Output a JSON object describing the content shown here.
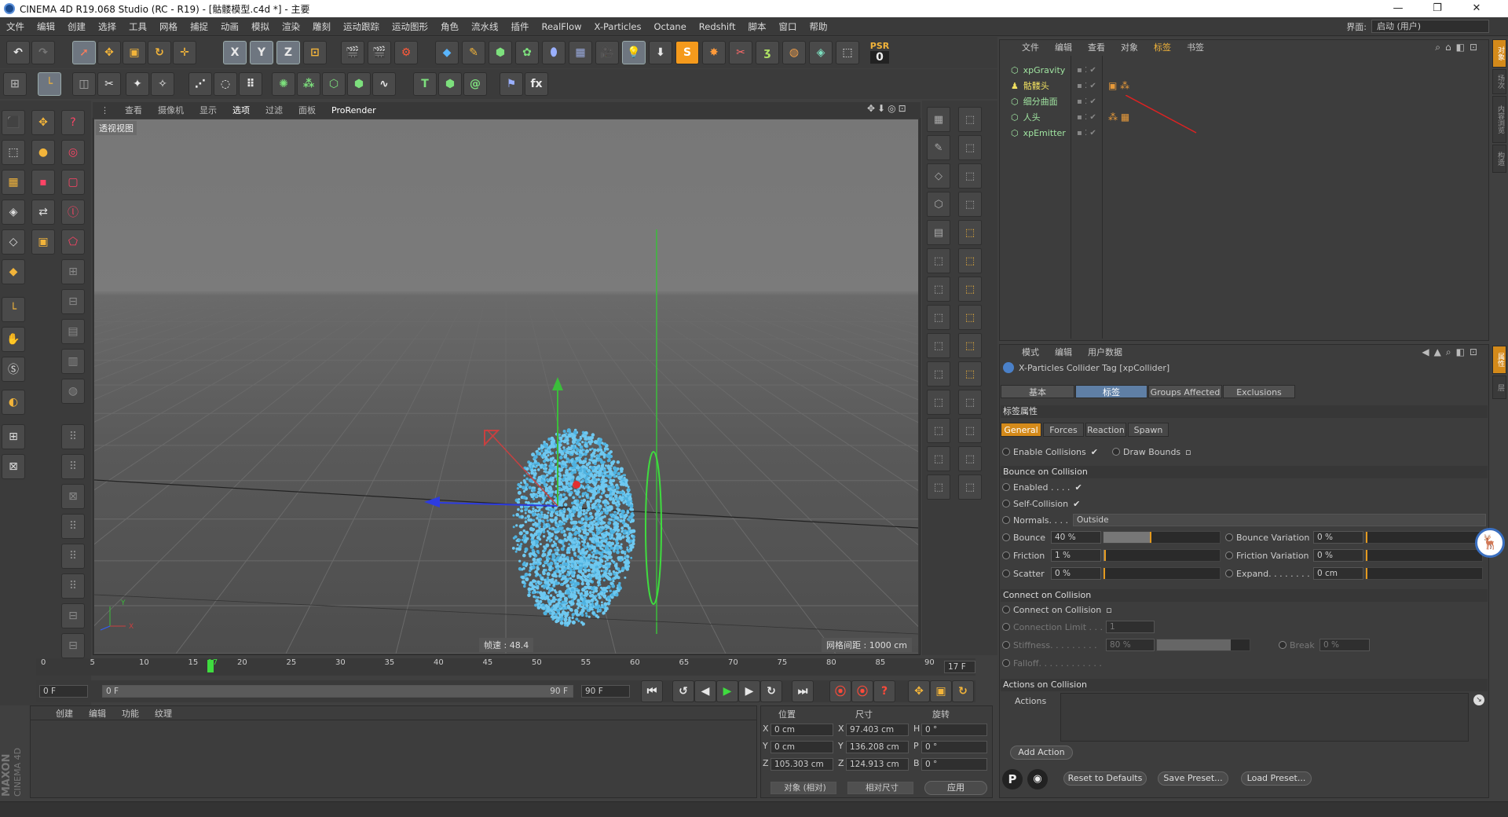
{
  "window": {
    "title": "CINEMA 4D R19.068 Studio (RC - R19) - [骷髅模型.c4d *] - 主要",
    "min": "—",
    "max": "❐",
    "close": "✕"
  },
  "menu": [
    "文件",
    "编辑",
    "创建",
    "选择",
    "工具",
    "网格",
    "捕捉",
    "动画",
    "模拟",
    "渲染",
    "雕刻",
    "运动跟踪",
    "运动图形",
    "角色",
    "流水线",
    "插件",
    "RealFlow",
    "X-Particles",
    "Octane",
    "Redshift",
    "脚本",
    "窗口",
    "帮助"
  ],
  "interface": {
    "label": "界面:",
    "value": "启动 (用户)"
  },
  "toolbar": {
    "x": "X",
    "y": "Y",
    "z": "Z",
    "psr_label": "PSR",
    "psr_value": "0"
  },
  "viewport": {
    "menu": [
      "查看",
      "摄像机",
      "显示",
      "选项",
      "过滤",
      "面板",
      "ProRender"
    ],
    "label": "透视视图",
    "fps": "帧速 : 48.4",
    "grid": "网格间距 : 1000 cm"
  },
  "timeline": {
    "ticks": [
      "0",
      "5",
      "10",
      "15",
      "17",
      "20",
      "25",
      "30",
      "35",
      "40",
      "45",
      "50",
      "55",
      "60",
      "65",
      "70",
      "75",
      "80",
      "85",
      "90"
    ],
    "current_frame": "17 F",
    "start": "0 F",
    "range_start": "0 F",
    "range_end": "90 F",
    "end": "90 F"
  },
  "materials": {
    "menu": [
      "创建",
      "编辑",
      "功能",
      "纹理"
    ],
    "brand1": "MAXON",
    "brand2": "CINEMA 4D"
  },
  "coords": {
    "headers": [
      "位置",
      "尺寸",
      "旋转"
    ],
    "rows": [
      {
        "a": "X",
        "pos": "0 cm",
        "b": "X",
        "size": "97.403 cm",
        "c": "H",
        "rot": "0 °"
      },
      {
        "a": "Y",
        "pos": "0 cm",
        "b": "Y",
        "size": "136.208 cm",
        "c": "P",
        "rot": "0 °"
      },
      {
        "a": "Z",
        "pos": "105.303 cm",
        "b": "Z",
        "size": "124.913 cm",
        "c": "B",
        "rot": "0 °"
      }
    ],
    "mode1": "对象 (相对)",
    "mode2": "相对尺寸",
    "apply": "应用"
  },
  "objects": {
    "menu": [
      "文件",
      "编辑",
      "查看",
      "对象",
      "标签",
      "书签"
    ],
    "items": [
      {
        "name": "xpGravity",
        "color": "#9fe3a0"
      },
      {
        "name": "骷髅头",
        "color": "#f0e060"
      },
      {
        "name": "细分曲面",
        "color": "#9fe3a0"
      },
      {
        "name": "人头",
        "color": "#9fe3a0"
      },
      {
        "name": "xpEmitter",
        "color": "#9fe3a0"
      }
    ]
  },
  "attributes": {
    "menu": [
      "模式",
      "编辑",
      "用户数据"
    ],
    "title": "X-Particles Collider Tag [xpCollider]",
    "tabs": [
      "基本",
      "标签",
      "Groups Affected",
      "Exclusions"
    ],
    "section": "标签属性",
    "subtabs": [
      "General",
      "Forces",
      "Reaction",
      "Spawn"
    ],
    "enable_collisions": "Enable Collisions",
    "draw_bounds": "Draw Bounds",
    "bounce_head": "Bounce on Collision",
    "enabled": "Enabled . . . .",
    "self_collision": "Self-Collision",
    "normals": "Normals. . . .",
    "normals_value": "Outside",
    "bounce": {
      "label": "Bounce",
      "value": "40 %",
      "level": 0.4
    },
    "bounce_var": {
      "label": "Bounce Variation",
      "value": "0 %"
    },
    "friction": {
      "label": "Friction",
      "value": "1 %",
      "level": 0.01
    },
    "friction_var": {
      "label": "Friction Variation",
      "value": "0 %"
    },
    "scatter": {
      "label": "Scatter",
      "value": "0 %"
    },
    "expand": {
      "label": "Expand. . . . . . . . .",
      "value": "0 cm"
    },
    "connect_head": "Connect on Collision",
    "connect": "Connect on Collision",
    "conn_limit": {
      "label": "Connection Limit . . .",
      "value": "1"
    },
    "stiffness": {
      "label": "Stiffness. . . . . . . . .",
      "value": "80 %",
      "level": 0.8
    },
    "break": {
      "label": "Break",
      "value": "0 %"
    },
    "falloff": "Falloff. . . . . . . . . . . .",
    "actions_head": "Actions on Collision",
    "actions": "Actions",
    "add_action": "Add Action",
    "reset": "Reset to Defaults",
    "save": "Save Preset...",
    "load": "Load Preset..."
  },
  "colors": {
    "accent": "#d48a1a",
    "tab_active": "#5f7fa5",
    "particles": "#6ec8f0"
  }
}
